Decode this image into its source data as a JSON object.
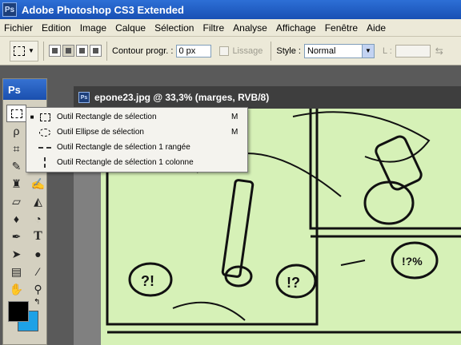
{
  "app": {
    "title": "Adobe Photoshop CS3 Extended",
    "logo": "Ps"
  },
  "menu": [
    {
      "label": "Fichier"
    },
    {
      "label": "Edition"
    },
    {
      "label": "Image"
    },
    {
      "label": "Calque"
    },
    {
      "label": "Sélection"
    },
    {
      "label": "Filtre"
    },
    {
      "label": "Analyse"
    },
    {
      "label": "Affichage"
    },
    {
      "label": "Fenêtre"
    },
    {
      "label": "Aide"
    }
  ],
  "options": {
    "feather_label": "Contour progr. :",
    "feather_value": "0 px",
    "antialias_label": "Lissage",
    "style_label": "Style :",
    "style_value": "Normal",
    "width_label": "L :",
    "selection_mode_active": 2
  },
  "toolbox": {
    "header": "Ps",
    "foreground_color": "#000000",
    "background_color": "#1da1e6"
  },
  "document": {
    "title": "epone23.jpg @ 33,3% (marges, RVB/8)",
    "canvas_color": "#d6f1b7"
  },
  "flyout": {
    "items": [
      {
        "label": "Outil Rectangle de sélection",
        "shortcut": "M",
        "icon": "rect-marquee-icon",
        "current": true
      },
      {
        "label": "Outil Ellipse de sélection",
        "shortcut": "M",
        "icon": "ellipse-marquee-icon",
        "current": false
      },
      {
        "label": "Outil Rectangle de sélection 1 rangée",
        "shortcut": "",
        "icon": "single-row-marquee-icon",
        "current": false
      },
      {
        "label": "Outil Rectangle de sélection 1 colonne",
        "shortcut": "",
        "icon": "single-column-marquee-icon",
        "current": false
      }
    ]
  }
}
